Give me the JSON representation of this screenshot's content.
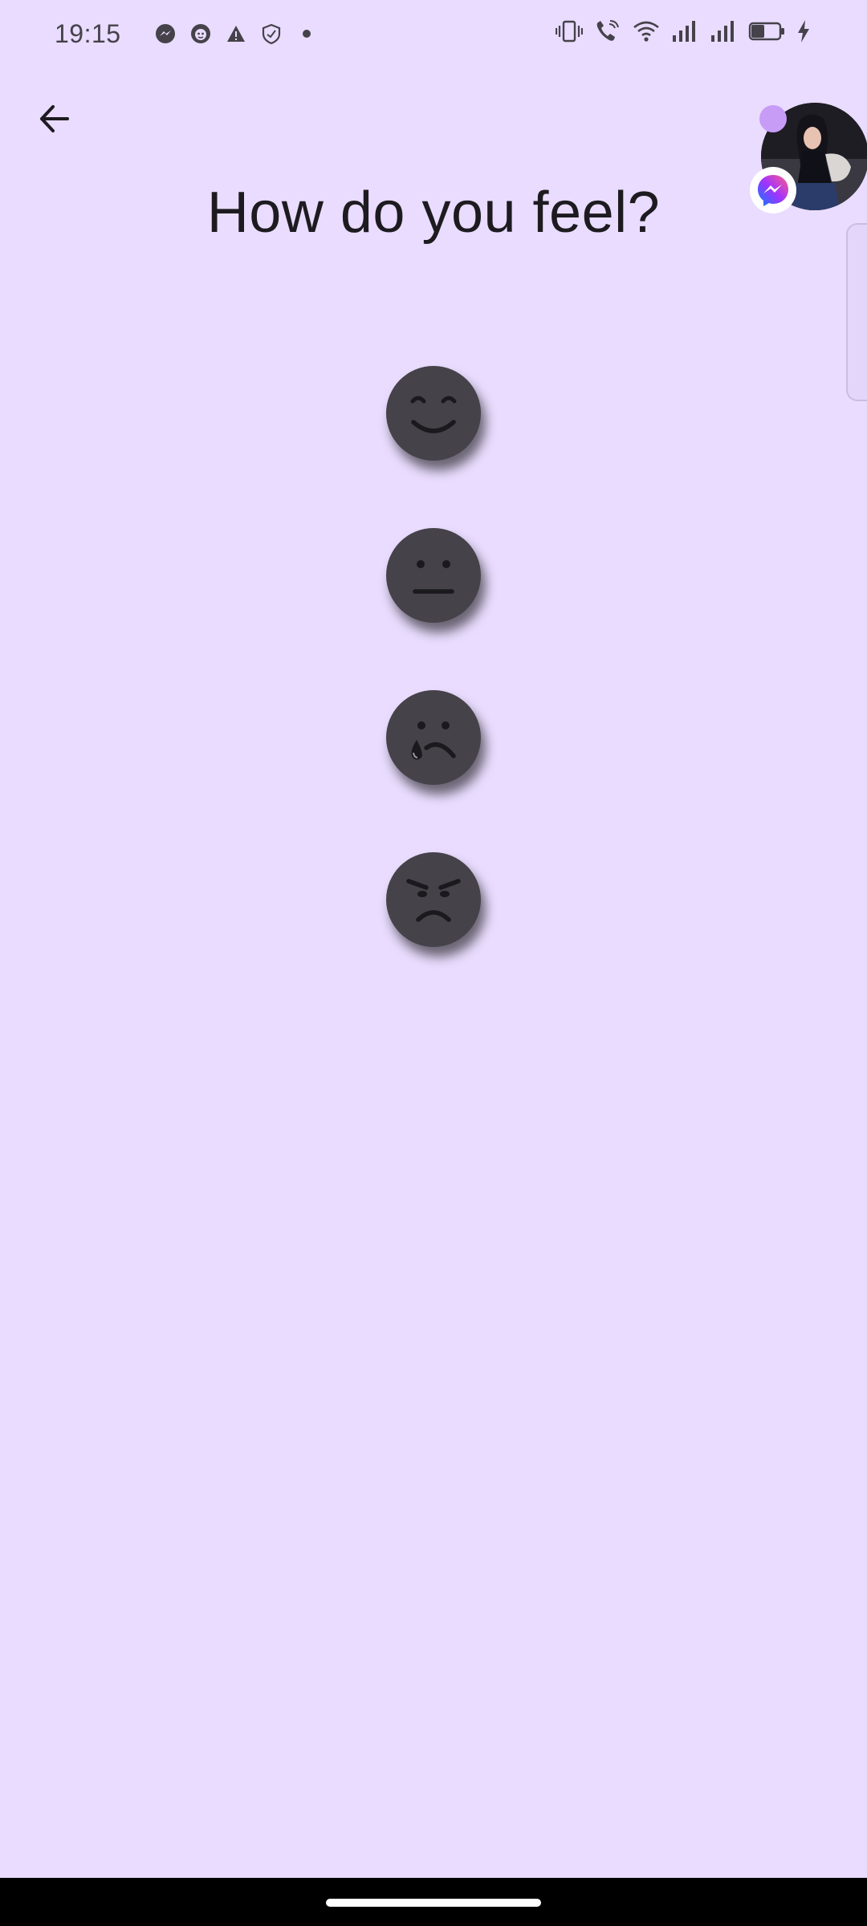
{
  "status_bar": {
    "time": "19:15",
    "left_icons": [
      "messenger-icon",
      "cat-face-icon",
      "warning-icon",
      "shield-icon",
      "dot-icon"
    ],
    "right_icons": [
      "vibrate-icon",
      "wifi-call-icon",
      "wifi-icon",
      "signal-icon",
      "signal-icon",
      "battery-icon",
      "charging-bolt-icon"
    ]
  },
  "header": {
    "back_icon": "arrow-left-icon",
    "title": "How do you feel?"
  },
  "moods": [
    {
      "id": "happy",
      "icon": "smiling-face-icon"
    },
    {
      "id": "neutral",
      "icon": "neutral-face-icon"
    },
    {
      "id": "sad",
      "icon": "crying-face-icon"
    },
    {
      "id": "angry",
      "icon": "angry-face-icon"
    }
  ],
  "chat_head": {
    "app": "Messenger",
    "badge_icon": "messenger-icon",
    "dot_color": "#c79cf6"
  },
  "colors": {
    "background": "#e9dcfe",
    "face": "#45424a",
    "title": "#1d1b20"
  }
}
